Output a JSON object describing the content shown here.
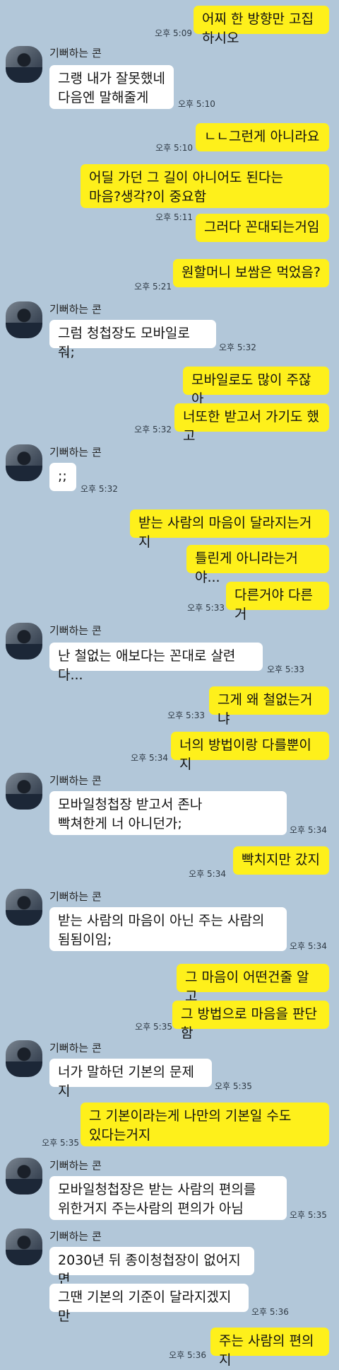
{
  "chat": {
    "sender_name": "기뻐하는 콘",
    "messages": [
      {
        "text": "어찌 한 방향만 고집하시오",
        "time": "오후 5:09"
      },
      {
        "text": "그랭 내가 잘못했네\n다음엔 말해줄게",
        "time": "오후 5:10"
      },
      {
        "text": "ㄴㄴ그런게 아니라요",
        "time": "오후 5:10"
      },
      {
        "text": "어딜 가던 그 길이 아니어도 된다는\n마음?생각?이 중요함",
        "time": ""
      },
      {
        "text": "그러다 꼰대되는거임",
        "time": "오후 5:11"
      },
      {
        "text": "원할머니 보쌈은 먹었음?",
        "time": "오후 5:21"
      },
      {
        "text": "그럼 청첩장도 모바일로 줘;",
        "time": "오후 5:32"
      },
      {
        "text": "모바일로도 많이 주잖아",
        "time": ""
      },
      {
        "text": "너또한 받고서 가기도 했고",
        "time": "오후 5:32"
      },
      {
        "text": ";;",
        "time": "오후 5:32"
      },
      {
        "text": "받는 사람의 마음이 달라지는거지",
        "time": ""
      },
      {
        "text": "틀린게 아니라는거야...",
        "time": ""
      },
      {
        "text": "다른거야 다른거",
        "time": "오후 5:33"
      },
      {
        "text": "난 철없는 애보다는 꼰대로 살련다...",
        "time": "오후 5:33"
      },
      {
        "text": "그게 왜 철없는거냐",
        "time": "오후 5:33"
      },
      {
        "text": "너의 방법이랑 다를뿐이지",
        "time": "오후 5:34"
      },
      {
        "text": "     모바일청첩장 받고서 존나\n빡쳐한게 너 아니던가;",
        "time": "오후 5:34"
      },
      {
        "text": "빡치지만 갔지",
        "time": "오후 5:34"
      },
      {
        "text": "받는 사람의 마음이 아닌 주는 사람의\n됨됨이임;",
        "time": "오후 5:34"
      },
      {
        "text": "그 마음이 어떤건줄 알고",
        "time": ""
      },
      {
        "text": "그 방법으로 마음을 판단함",
        "time": "오후 5:35"
      },
      {
        "text": "너가 말하던 기본의 문제지",
        "time": "오후 5:35"
      },
      {
        "text": "그 기본이라는게 나만의 기본일 수도\n있다는거지",
        "time": "오후 5:35"
      },
      {
        "text": "모바일청첩장은 받는 사람의 편의를\n위한거지 주는사람의 편의가 아님",
        "time": "오후 5:35"
      },
      {
        "text": "2030년 뒤 종이청첩장이 없어지면",
        "time": ""
      },
      {
        "text": "그땐 기본의 기준이 달라지겠지만",
        "time": "오후 5:36"
      },
      {
        "text": "주는 사람의 편의지",
        "time": "오후 5:36"
      }
    ]
  }
}
